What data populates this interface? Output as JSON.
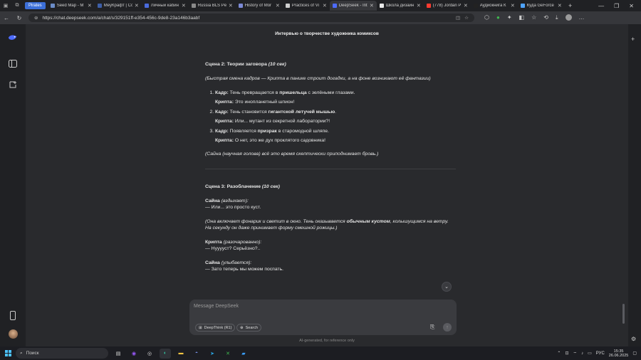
{
  "browser": {
    "tab_group": "Pirates",
    "tabs": [
      {
        "label": "Seed Map - M",
        "color": "#6b8cc7",
        "active": false
      },
      {
        "label": "МеуКрафт | Сс",
        "color": "#3d5fa8",
        "active": false
      },
      {
        "label": "Личный кабин",
        "color": "#4a6bdc",
        "active": false
      },
      {
        "label": "Russia BLS Per",
        "color": "#8a8a8a",
        "active": false
      },
      {
        "label": "History of Mor",
        "color": "#7c8ad6",
        "active": false
      },
      {
        "label": "Practices of Vi",
        "color": "#cfcfcf",
        "active": false
      },
      {
        "label": "DeepSeek - Inte",
        "color": "#4d6bfe",
        "active": true
      },
      {
        "label": "Школа дизайн",
        "color": "#e8e8e8",
        "active": false
      },
      {
        "label": "(778) Jordan P",
        "color": "#ff3b30",
        "active": false
      },
      {
        "label": "Аудиокнига К",
        "color": "#222222",
        "active": false
      },
      {
        "label": "Куда GeForce",
        "color": "#4ea3ff",
        "active": false
      }
    ],
    "url": "https://chat.deepseek.com/a/chat/s/329151ff-e354-456c-9de8-23a146b3aabf"
  },
  "chat": {
    "title": "Интервью о творчестве художника комиксов",
    "scene2": {
      "heading": "Сцена 2: Теории заговора",
      "duration": "(10 сек)",
      "stage": "(Быстрая смена кадров — Крипта в панике строит догадки, а на фоне возникают её фантазии)",
      "items": [
        {
          "kadr_label": "Кадр:",
          "kadr_pre": "Тень превращается в",
          "kadr_bold": "пришельца",
          "kadr_post": "с зелёными глазами.",
          "kripta_label": "Крипта:",
          "kripta_text": "Это инопланетный шпион!"
        },
        {
          "kadr_label": "Кадр:",
          "kadr_pre": "Тень становится",
          "kadr_bold": "гигантской летучей мышью",
          "kadr_post": ".",
          "kripta_label": "Крипта:",
          "kripta_text": "Или... мутант из секретной лаборатории?!"
        },
        {
          "kadr_label": "Кадр:",
          "kadr_pre": "Появляется",
          "kadr_bold": "призрак",
          "kadr_post": "в старомодной шляпе.",
          "kripta_label": "Крипта:",
          "kripta_text": "О нет, это же дух проклятого садовника!"
        }
      ],
      "closing": "(Сайна (научная голова) всё это время скептически приподнимает бровь.)"
    },
    "scene3": {
      "heading": "Сцена 3: Разоблачение",
      "duration": "(10 сек)",
      "saina1_name": "Сайна",
      "saina1_note": "(вздыхает):",
      "saina1_line": "— Или... это просто куст.",
      "stage_pre": "(Она включает фонарик и светит в окно. Тень оказывается",
      "stage_bold": "обычным кустом",
      "stage_post": ", колышущимся на ветру. На секунду он даже принимает форму смешной рожицы.)",
      "kripta_name": "Крипта",
      "kripta_note": "(разочарованно):",
      "kripta_line": "— Нууууст? Серьёзно?..",
      "saina2_name": "Сайна",
      "saina2_note": "(улыбается):",
      "saina2_line": "— Зато теперь мы можем поспать."
    }
  },
  "composer": {
    "placeholder": "Message DeepSeek",
    "deepthink_label": "DeepThink (R1)",
    "search_label": "Search"
  },
  "disclaimer": "AI-generated, for reference only",
  "taskbar": {
    "search_placeholder": "Поиск",
    "lang": "РУС",
    "time": "15:35",
    "date": "26.06.2025"
  }
}
